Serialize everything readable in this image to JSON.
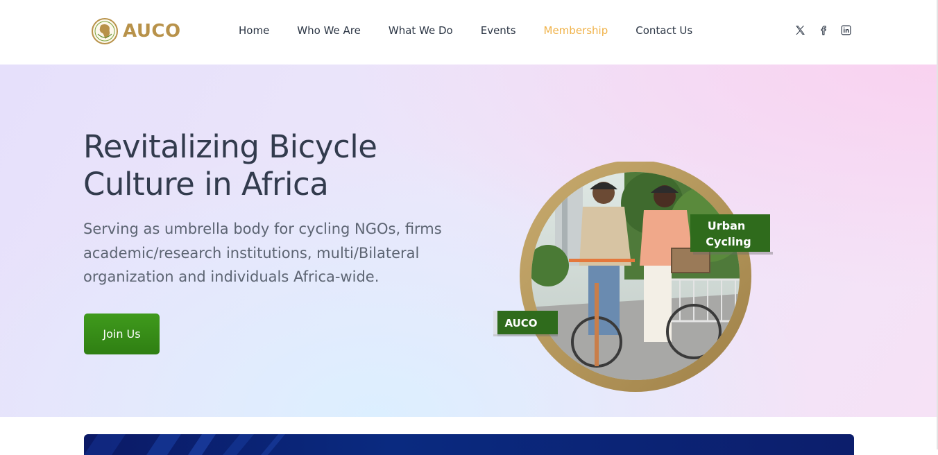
{
  "brand": {
    "name": "AUCO",
    "color": "#b8924a"
  },
  "nav": {
    "items": [
      {
        "label": "Home",
        "active": false
      },
      {
        "label": "Who We Are",
        "active": false
      },
      {
        "label": "What We Do",
        "active": false
      },
      {
        "label": "Events",
        "active": false
      },
      {
        "label": "Membership",
        "active": true
      },
      {
        "label": "Contact Us",
        "active": false
      }
    ],
    "active_color": "#f0b249"
  },
  "social": [
    {
      "icon": "x-icon"
    },
    {
      "icon": "facebook-icon"
    },
    {
      "icon": "linkedin-icon"
    }
  ],
  "hero": {
    "title": "Revitalizing Bicycle Culture in Africa",
    "subtitle": "Serving as umbrella body for cycling NGOs, firms academic/research institutions, multi/Bilateral organization and individuals Africa-wide.",
    "cta_label": "Join Us",
    "cta_color": "#3f9a1c",
    "image": {
      "badge_urban": "Urban Cycling",
      "badge_brand": "AUCO",
      "ring_color": "#b89a5e",
      "badge_color": "#2f6b1c"
    }
  }
}
